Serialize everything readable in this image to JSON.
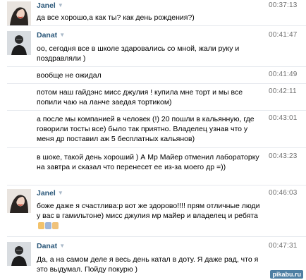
{
  "colors": {
    "author": "#2b587a",
    "time": "#6f6f6f",
    "separator": "#e6e9ee",
    "watermark": "#4e7fa3"
  },
  "messages": [
    {
      "author": "Janel",
      "time": "00:37:13",
      "text": "да все хорошо,а как ты? как день рождения?)"
    },
    {
      "author": "Danat",
      "time": "00:41:47",
      "text": "оо, сегодня все в школе здаровались со мной, жали руку и поздравляли )"
    },
    {
      "time": "00:41:49",
      "text": "вообще не ожидал"
    },
    {
      "time": "00:42:11",
      "text": "потом наш гайдэнс мисс джулия ! купила мне торт и мы все попили чаю на ланче заедая тортиком)"
    },
    {
      "time": "00:43:01",
      "text": "а после мы компанией в человек (!) 20 пошли в кальянную, где говорили тосты все) было так приятно. Владелец узнав что у меня др поставил аж 5 бесплатных кальянов)"
    },
    {
      "time": "00:43:23",
      "text": "в шоке, такой день хороший ) А Мр Майер отменил лабораторку на завтра и сказал что перенесет ее из-за моего др =))"
    },
    {
      "author": "Janel",
      "time": "00:46:03",
      "text": "боже даже я счастлива:р вот же здорово!!!! прям отличные люди у вас в гамильтоне) мисс джулия мр майер и владелец и ребята"
    },
    {
      "author": "Danat",
      "time": "00:47:31",
      "text": "Да, а на самом деле я весь день катал в доту. Я даже рад, что я это выдумал. Пойду покурю )"
    }
  ],
  "watermark": "pikabu.ru"
}
